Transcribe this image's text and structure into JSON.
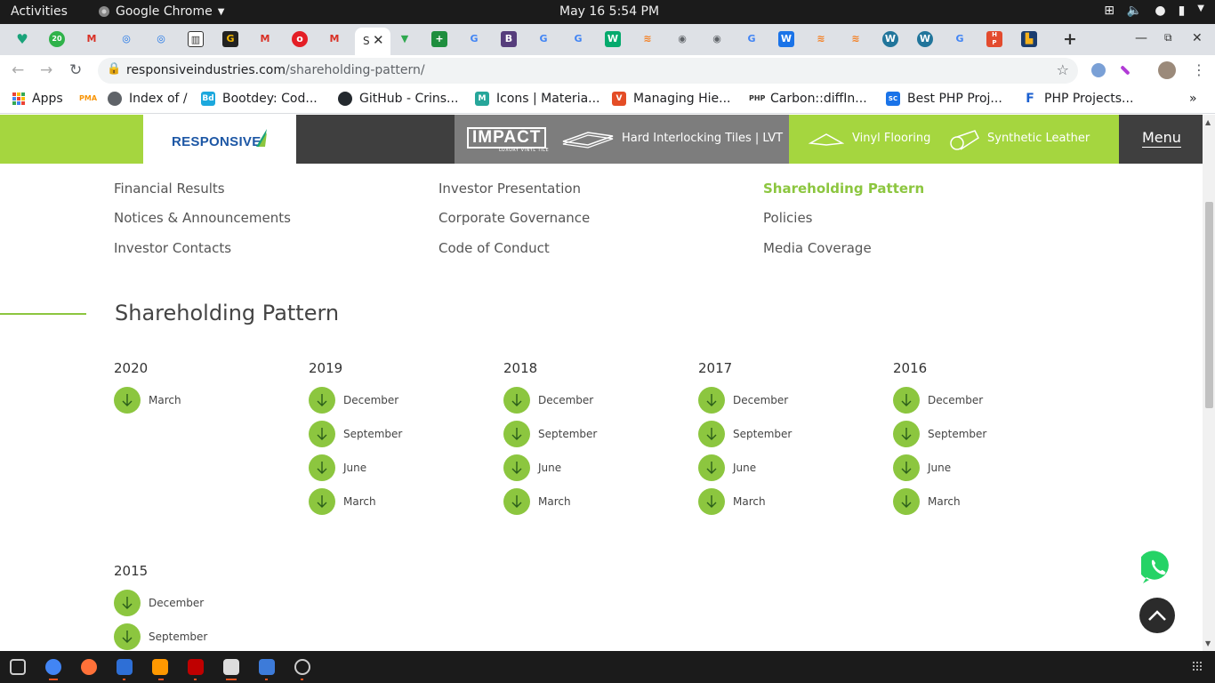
{
  "system": {
    "activities": "Activities",
    "app_name": "Google Chrome",
    "clock": "May 16  5:54 PM"
  },
  "browser": {
    "active_tab_letter": "S",
    "url_domain": "responsiveindustries.com",
    "url_path": "/shareholding-pattern/",
    "bookmarks": [
      {
        "label": "Apps",
        "icon": "apps-grid-icon"
      },
      {
        "label": "Index of /",
        "icon": "globe-icon"
      },
      {
        "label": "Bootdey: Cod...",
        "icon": "bootdey-icon"
      },
      {
        "label": "GitHub - Crins...",
        "icon": "github-icon"
      },
      {
        "label": "Icons | Materia...",
        "icon": "materialize-icon"
      },
      {
        "label": "Managing Hie...",
        "icon": "mysql-icon"
      },
      {
        "label": "Carbon::diffIn...",
        "icon": "php-icon"
      },
      {
        "label": "Best PHP Proj...",
        "icon": "code-icon"
      },
      {
        "label": "PHP Projects...",
        "icon": "f-icon"
      }
    ]
  },
  "site": {
    "logo": "RESPONSIVE",
    "impact_logo": "IMPACT",
    "impact_sub": "LUXURY VINYL TILE",
    "nav": {
      "impact_label": "Hard Interlocking Tiles | LVT",
      "vinyl_label": "Vinyl Flooring",
      "leather_label": "Synthetic Leather",
      "menu_label": "Menu"
    },
    "investor_links": [
      {
        "label": "Financial Results",
        "active": false
      },
      {
        "label": "Investor Presentation",
        "active": false
      },
      {
        "label": "Shareholding Pattern",
        "active": true
      },
      {
        "label": "Notices & Announcements",
        "active": false
      },
      {
        "label": "Corporate Governance",
        "active": false
      },
      {
        "label": "Policies",
        "active": false
      },
      {
        "label": "Investor Contacts",
        "active": false
      },
      {
        "label": "Code of Conduct",
        "active": false
      },
      {
        "label": "Media Coverage",
        "active": false
      }
    ],
    "section_title": "Shareholding Pattern",
    "years": [
      {
        "year": "2020",
        "items": [
          "March"
        ]
      },
      {
        "year": "2019",
        "items": [
          "December",
          "September",
          "June",
          "March"
        ]
      },
      {
        "year": "2018",
        "items": [
          "December",
          "September",
          "June",
          "March"
        ]
      },
      {
        "year": "2017",
        "items": [
          "December",
          "September",
          "June",
          "March"
        ]
      },
      {
        "year": "2016",
        "items": [
          "December",
          "September",
          "June",
          "March"
        ]
      },
      {
        "year": "2015",
        "items": [
          "December",
          "September"
        ]
      }
    ],
    "accent_color": "#8cc63f"
  }
}
